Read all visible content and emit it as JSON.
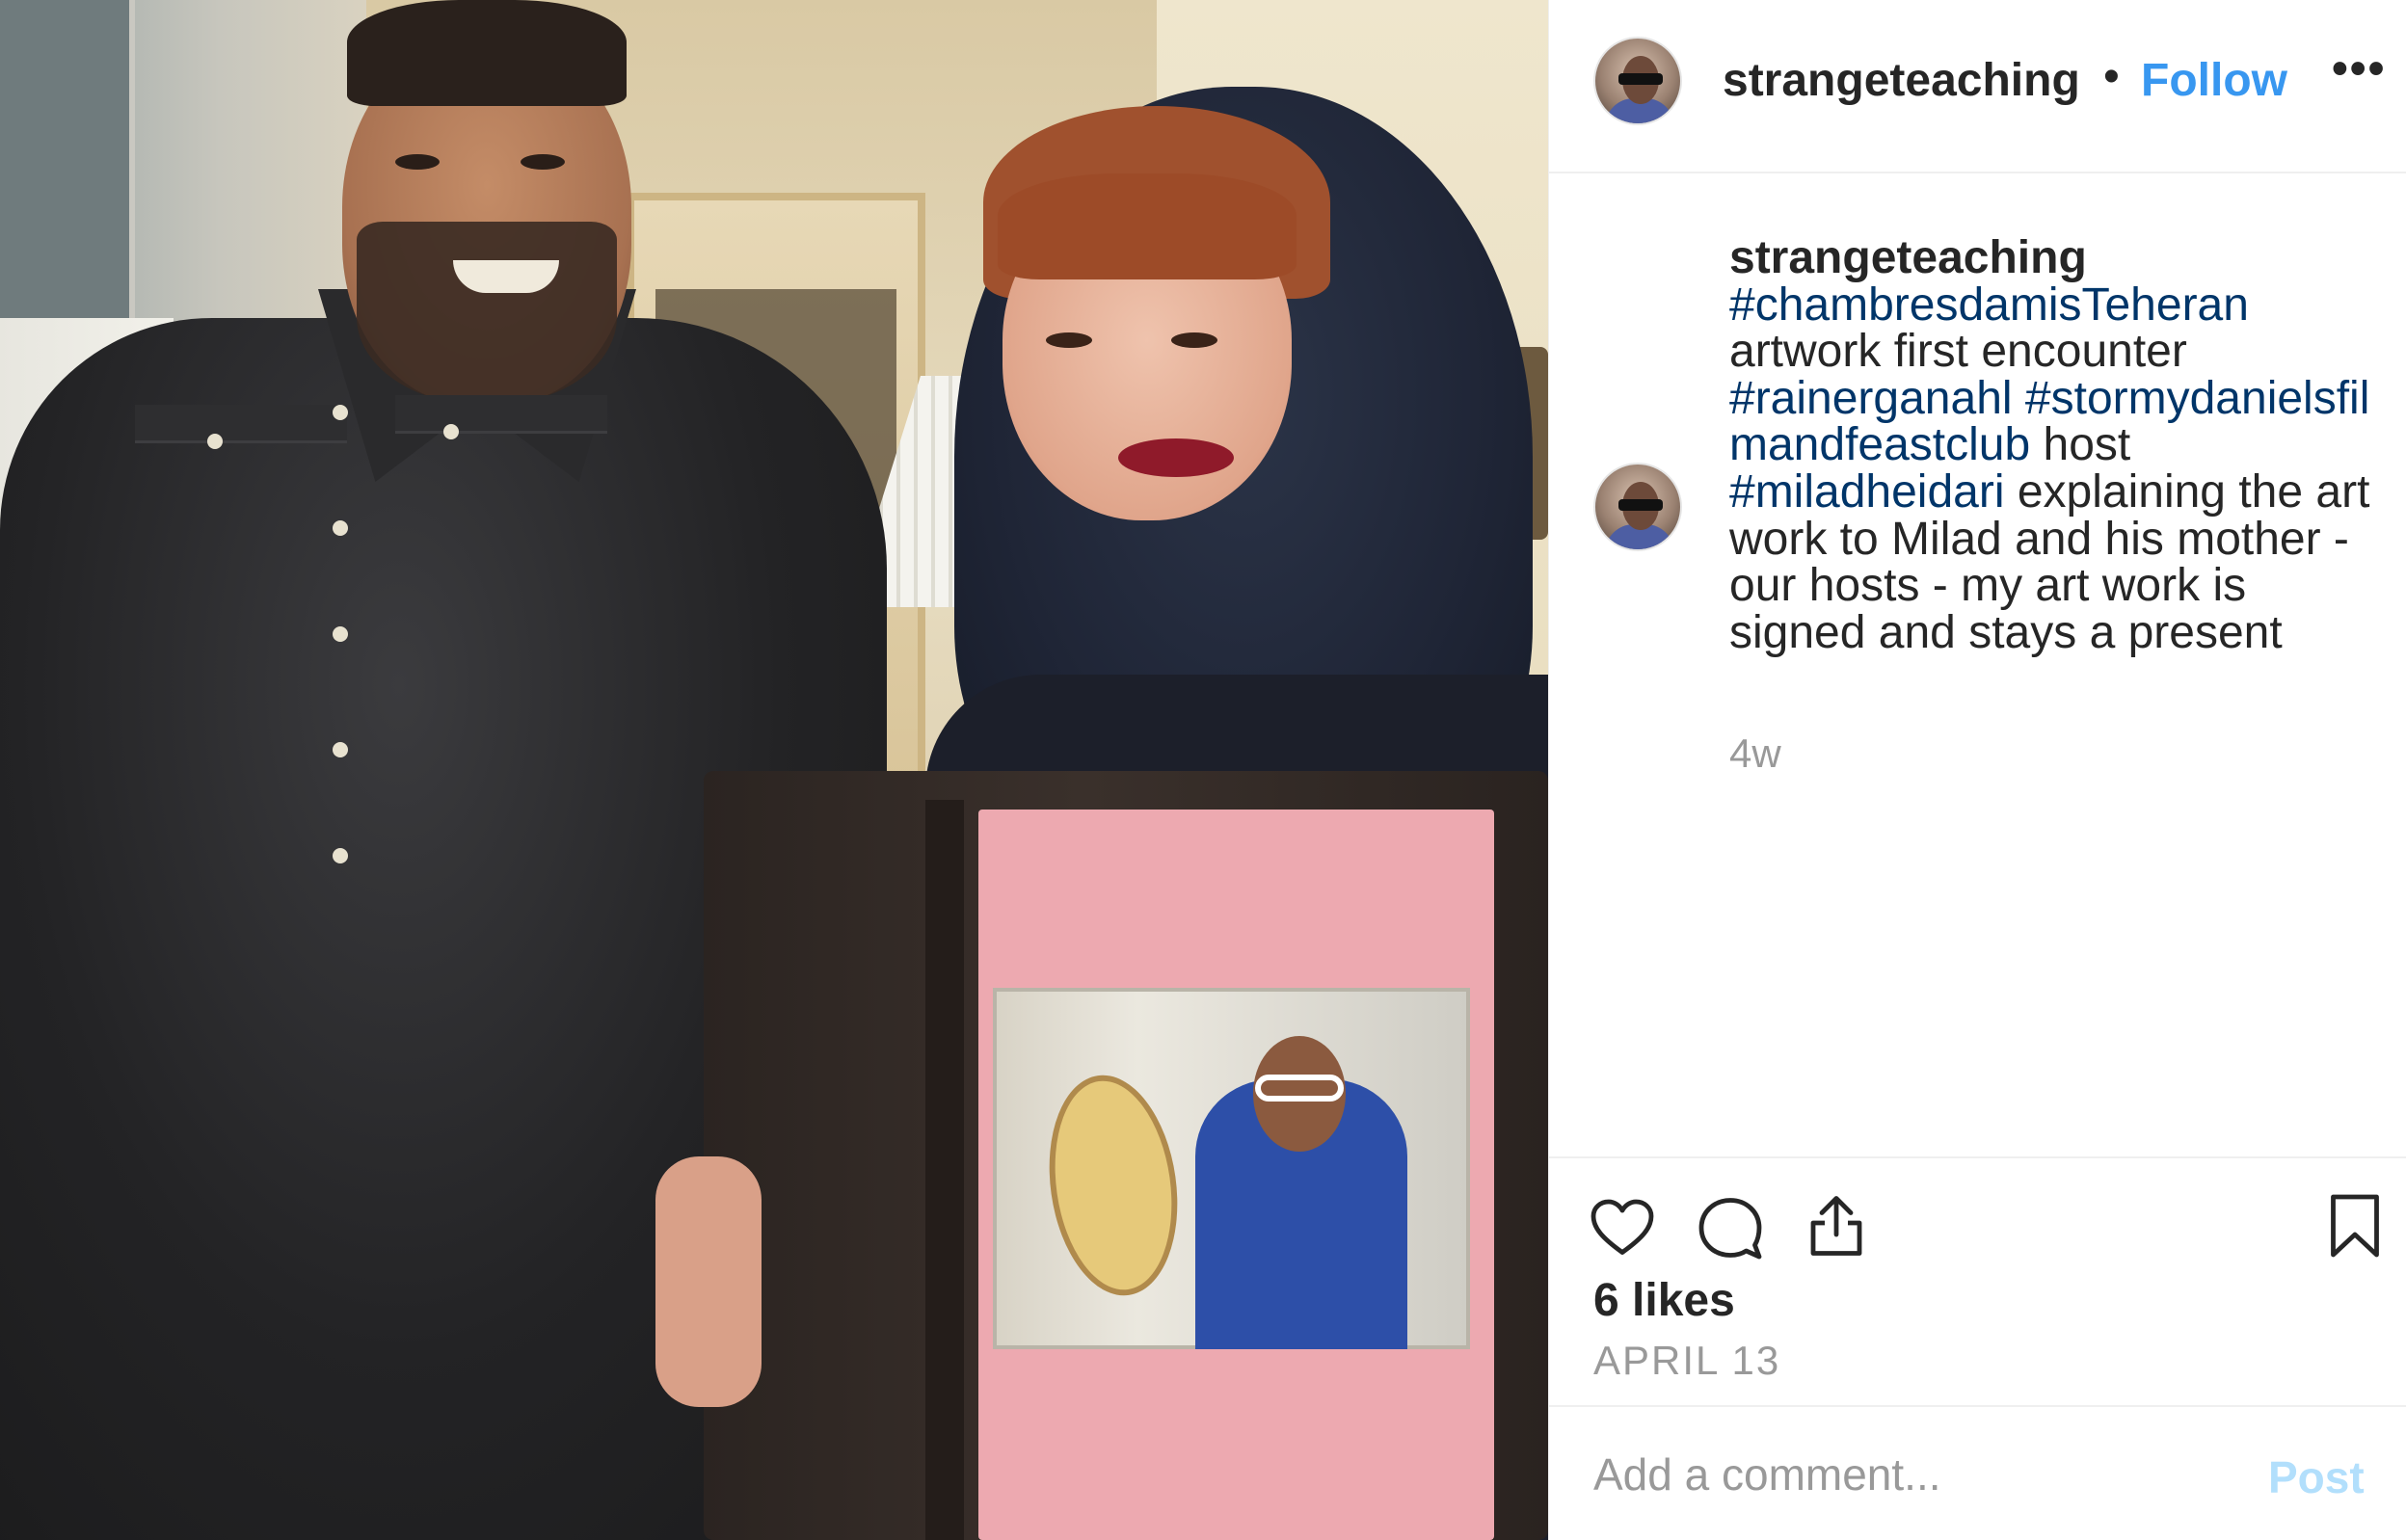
{
  "post": {
    "username": "strangeteaching",
    "follow_label": "Follow",
    "separator": "•",
    "more_label": "•••"
  },
  "caption": {
    "username": "strangeteaching",
    "tag1": "#chambresdamisTeheran",
    "text1": " artwork first encounter ",
    "tag2": "#rainerganahl",
    "text2": " ",
    "tag3": "#stormydanielsfilmandfeastclub",
    "text3": " host ",
    "tag4": "#miladheidari",
    "text4": " explaining the art work to Milad and his mother - our hosts - my art work is signed and stays a present",
    "time": "4w"
  },
  "actions": {
    "like_icon": "heart-icon",
    "comment_icon": "comment-icon",
    "share_icon": "share-icon",
    "save_icon": "bookmark-icon"
  },
  "stats": {
    "likes": "6 likes",
    "date": "APRIL 13"
  },
  "comment_box": {
    "placeholder": "Add a comment...",
    "post_label": "Post"
  },
  "colors": {
    "link_blue": "#3897f0",
    "hashtag": "#003569",
    "muted": "#999999",
    "post_disabled": "#b2dffc"
  }
}
